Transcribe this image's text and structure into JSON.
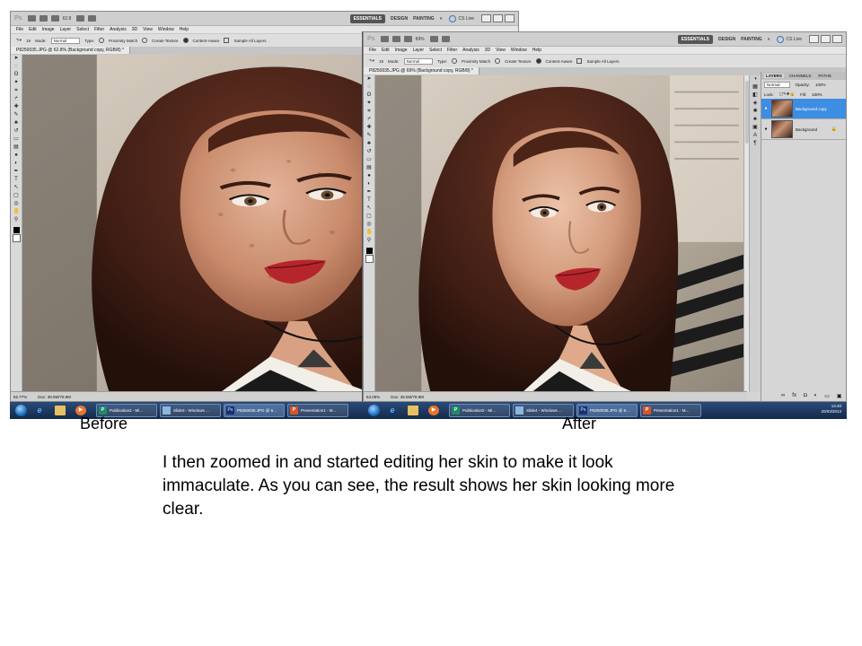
{
  "before_window": {
    "app_logo": "Ps",
    "zoom": "62.8",
    "workspace": {
      "active": "ESSENTIALS",
      "design": "DESIGN",
      "painting": "PAINTING",
      "more": "»"
    },
    "cs_live": "CS Live",
    "menu": [
      "File",
      "Edit",
      "Image",
      "Layer",
      "Select",
      "Filter",
      "Analysis",
      "3D",
      "View",
      "Window",
      "Help"
    ],
    "options": {
      "brush_size": "19",
      "mode_label": "Mode:",
      "mode_value": "Normal",
      "type_label": "Type:",
      "proximity": "Proximity Match",
      "texture": "Create Texture",
      "content_aware": "Content-Aware",
      "sample_all": "Sample All Layers"
    },
    "doc_tab": "P8250035.JPG @ 62.8% (Background copy, RGB/8) *",
    "status": {
      "zoom": "62.77%",
      "doc": "Doc: 39.5M/78.9M"
    }
  },
  "after_window": {
    "app_logo": "Ps",
    "zoom": "69%",
    "workspace": {
      "active": "ESSENTIALS",
      "design": "DESIGN",
      "painting": "PAINTING",
      "more": "»"
    },
    "cs_live": "CS Live",
    "menu": [
      "File",
      "Edit",
      "Image",
      "Layer",
      "Select",
      "Filter",
      "Analysis",
      "3D",
      "View",
      "Window",
      "Help"
    ],
    "options": {
      "brush_size": "19",
      "mode_label": "Mode:",
      "mode_value": "Normal",
      "type_label": "Type:",
      "proximity": "Proximity Match",
      "texture": "Create Texture",
      "content_aware": "Content-Aware",
      "sample_all": "Sample All Layers"
    },
    "doc_tab": "P8250035.JPG @ 69% (Background copy, RGB/8) *",
    "status": {
      "zoom": "64.05%",
      "doc": "Doc: 39.5M/78.9M"
    },
    "layers_panel": {
      "tabs": [
        "LAYERS",
        "CHANNELS",
        "PATHS"
      ],
      "blend_mode": "Normal",
      "opacity_label": "Opacity:",
      "opacity": "100%",
      "lock_label": "Lock:",
      "fill_label": "Fill:",
      "fill": "100%",
      "layers": [
        "Background copy",
        "Background"
      ]
    }
  },
  "taskbar": {
    "left_buttons": [
      "Publication2 - Mi...",
      "Slide3 - Windows ...",
      "P8250035.JPG @ 6...",
      "Presentation1 - M..."
    ],
    "right_buttons": [
      "Publication2 - Mi...",
      "Slide4 - Windows ...",
      "P8250035.JPG @ 6...",
      "Presentation1 - M..."
    ],
    "time": "14:40",
    "date": "20/03/2013"
  },
  "captions": {
    "before": "Before",
    "after": "After"
  },
  "description": "I then zoomed in and started editing her skin to make it look immaculate. As you can see, the result shows her skin looking more clear.",
  "colors": {
    "accent_layer": "#3d8de3",
    "taskbar": "#1b3358",
    "lips": "#b5262c"
  }
}
